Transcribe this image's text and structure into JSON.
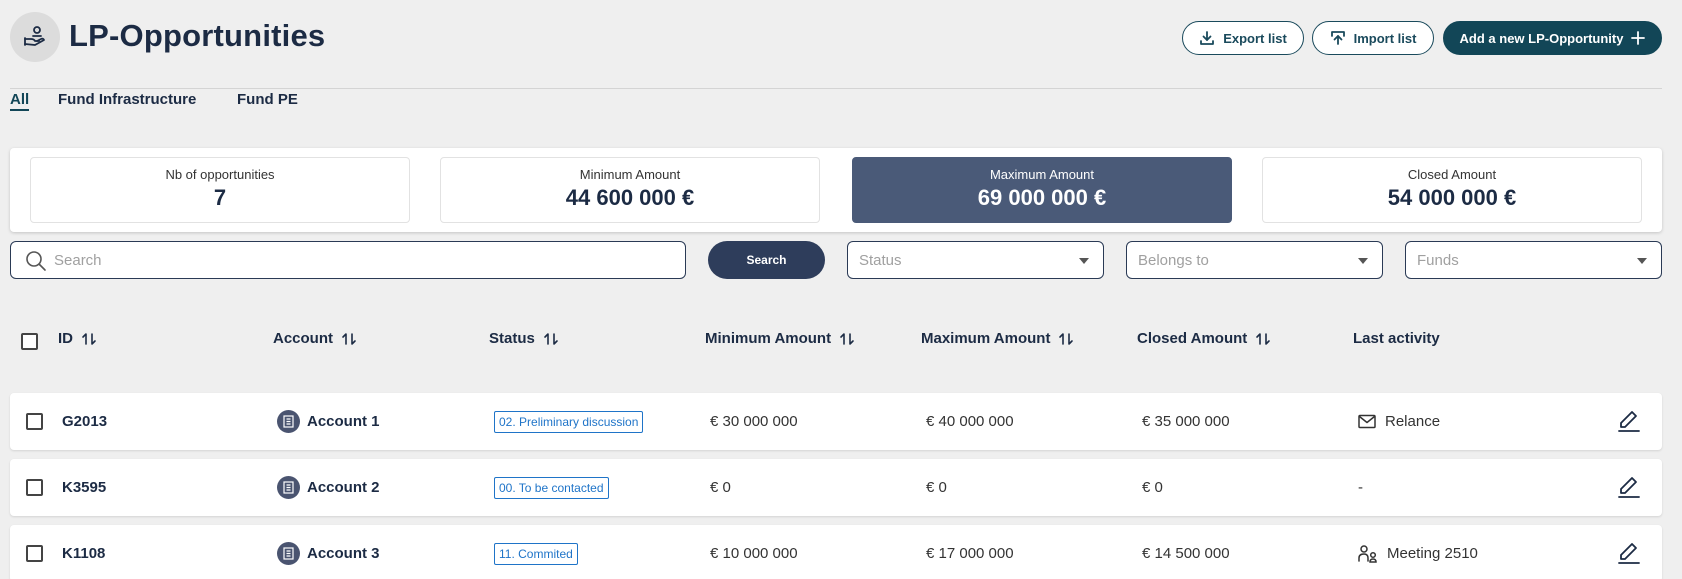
{
  "header": {
    "title": "LP-Opportunities",
    "export_label": "Export list",
    "import_label": "Import list",
    "add_label": "Add a new LP-Opportunity"
  },
  "tabs": [
    {
      "label": "All",
      "active": true
    },
    {
      "label": "Fund Infrastructure",
      "active": false
    },
    {
      "label": "Fund PE",
      "active": false
    }
  ],
  "kpis": [
    {
      "label": "Nb of opportunities",
      "value": "7"
    },
    {
      "label": "Minimum Amount",
      "value": "44 600 000 €"
    },
    {
      "label": "Maximum Amount",
      "value": "69 000 000 €"
    },
    {
      "label": "Closed Amount",
      "value": "54 000 000 €"
    }
  ],
  "filters": {
    "search_placeholder": "Search",
    "search_button": "Search",
    "status_placeholder": "Status",
    "belongs_placeholder": "Belongs to",
    "funds_placeholder": "Funds"
  },
  "table": {
    "columns": [
      "ID",
      "Account",
      "Status",
      "Minimum Amount",
      "Maximum Amount",
      "Closed Amount",
      "Last activity"
    ],
    "rows": [
      {
        "id": "G2013",
        "account": "Account 1",
        "status": "02. Preliminary discussion",
        "min": "€ 30 000 000",
        "max": "€ 40 000 000",
        "closed": "€ 35 000 000",
        "activity": "Relance",
        "activity_icon": "mail-icon"
      },
      {
        "id": "K3595",
        "account": "Account 2",
        "status": "00. To be contacted",
        "min": "€ 0",
        "max": "€ 0",
        "closed": "€ 0",
        "activity": "-",
        "activity_icon": ""
      },
      {
        "id": "K1108",
        "account": "Account 3",
        "status": "11. Commited",
        "min": "€ 10 000 000",
        "max": "€ 17 000 000",
        "closed": "€ 14 500 000",
        "activity": "Meeting 2510",
        "activity_icon": "people-icon"
      }
    ]
  },
  "colors": {
    "primary": "#124657",
    "kpi_highlight": "#4a5a78",
    "status_blue": "#1f74c8",
    "text_dark": "#1c2b44"
  }
}
